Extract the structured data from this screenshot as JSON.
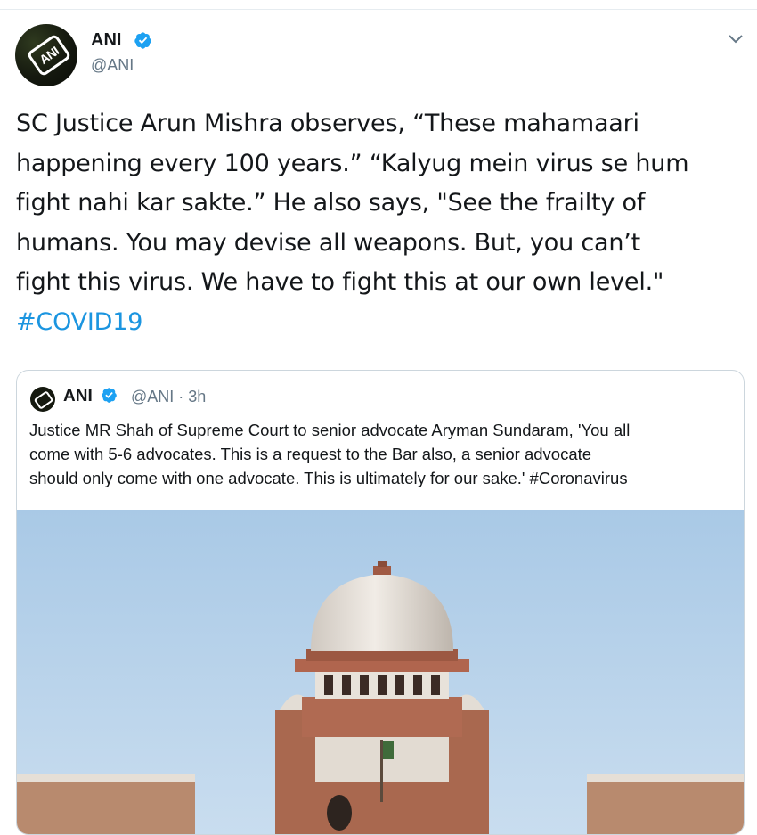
{
  "tweet": {
    "author_name": "ANI",
    "author_handle": "@ANI",
    "avatar_label": "ANI",
    "text": "SC Justice Arun Mishra observes, “These mahamaari\nhappening every 100 years.” “Kalyug mein virus se hum\nfight nahi kar sakte.” He also says, \"See the frailty of\nhumans. You may devise all weapons. But, you can’t\nfight this virus. We have to fight this at our own level.\"",
    "hashtag": "#COVID19"
  },
  "quoted": {
    "author_name": "ANI",
    "handle_time": "@ANI · 3h",
    "text": "Justice MR Shah of Supreme Court to senior advocate Aryman Sundaram, 'You all\ncome with 5-6 advocates. This is a request to the Bar also, a senior advocate\nshould only come with one advocate. This is ultimately for our sake.' #Coronavirus"
  },
  "colors": {
    "link": "#1b95e0",
    "verified": "#1da1f2",
    "secondary_text": "#657786",
    "border": "#ccd6dd"
  },
  "icons": [
    "verified-badge-icon",
    "chevron-down-icon"
  ]
}
